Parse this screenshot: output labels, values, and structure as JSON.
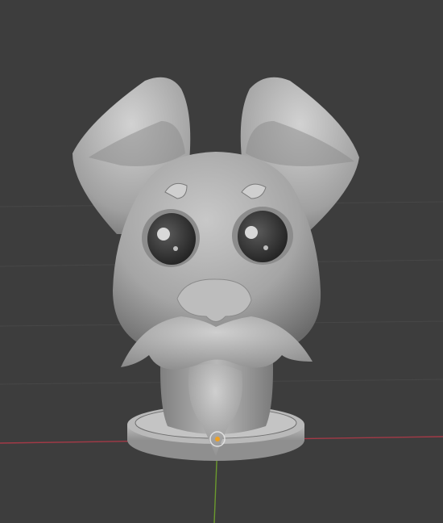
{
  "viewport": {
    "background": "#3d3d3d",
    "grid_color": "#474747",
    "x_axis_color": "#a33a47",
    "y_axis_color": "#6b9a2e",
    "model_color": "#a9a9a9",
    "model_shadow": "#5e5e5e",
    "model_highlight": "#dcdcdc"
  },
  "scene": {
    "object": "sculpted-dog-head-bust",
    "origin_marker_color": "#f0a020"
  }
}
